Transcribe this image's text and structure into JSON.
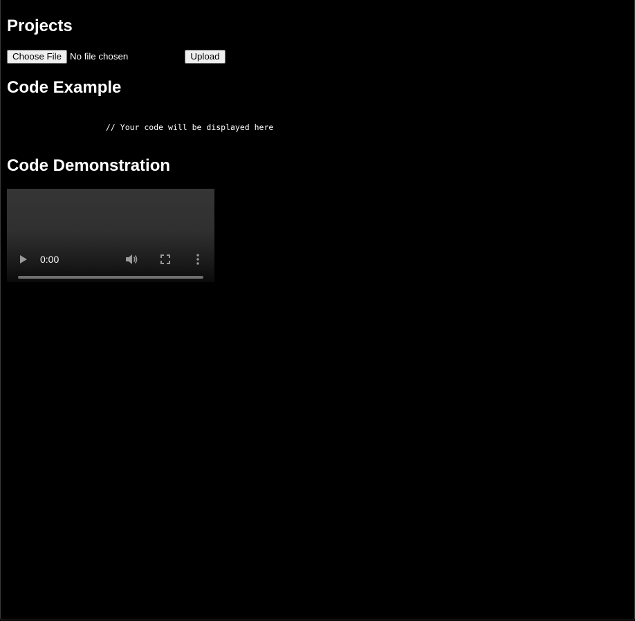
{
  "sections": {
    "projects_title": "Projects",
    "code_example_title": "Code Example",
    "code_demo_title": "Code Demonstration"
  },
  "upload": {
    "choose_label": "Choose File",
    "file_status": "No file chosen",
    "upload_label": "Upload"
  },
  "code": {
    "text": "// Your code will be displayed here"
  },
  "video": {
    "time": "0:00",
    "progress_fraction": 0,
    "icons": {
      "play": "play-icon",
      "volume": "volume-icon",
      "fullscreen": "fullscreen-icon",
      "more": "more-options-icon"
    }
  },
  "colors": {
    "background": "#000000",
    "text": "#ffffff",
    "button_bg": "#efefef",
    "button_border": "#767676"
  }
}
